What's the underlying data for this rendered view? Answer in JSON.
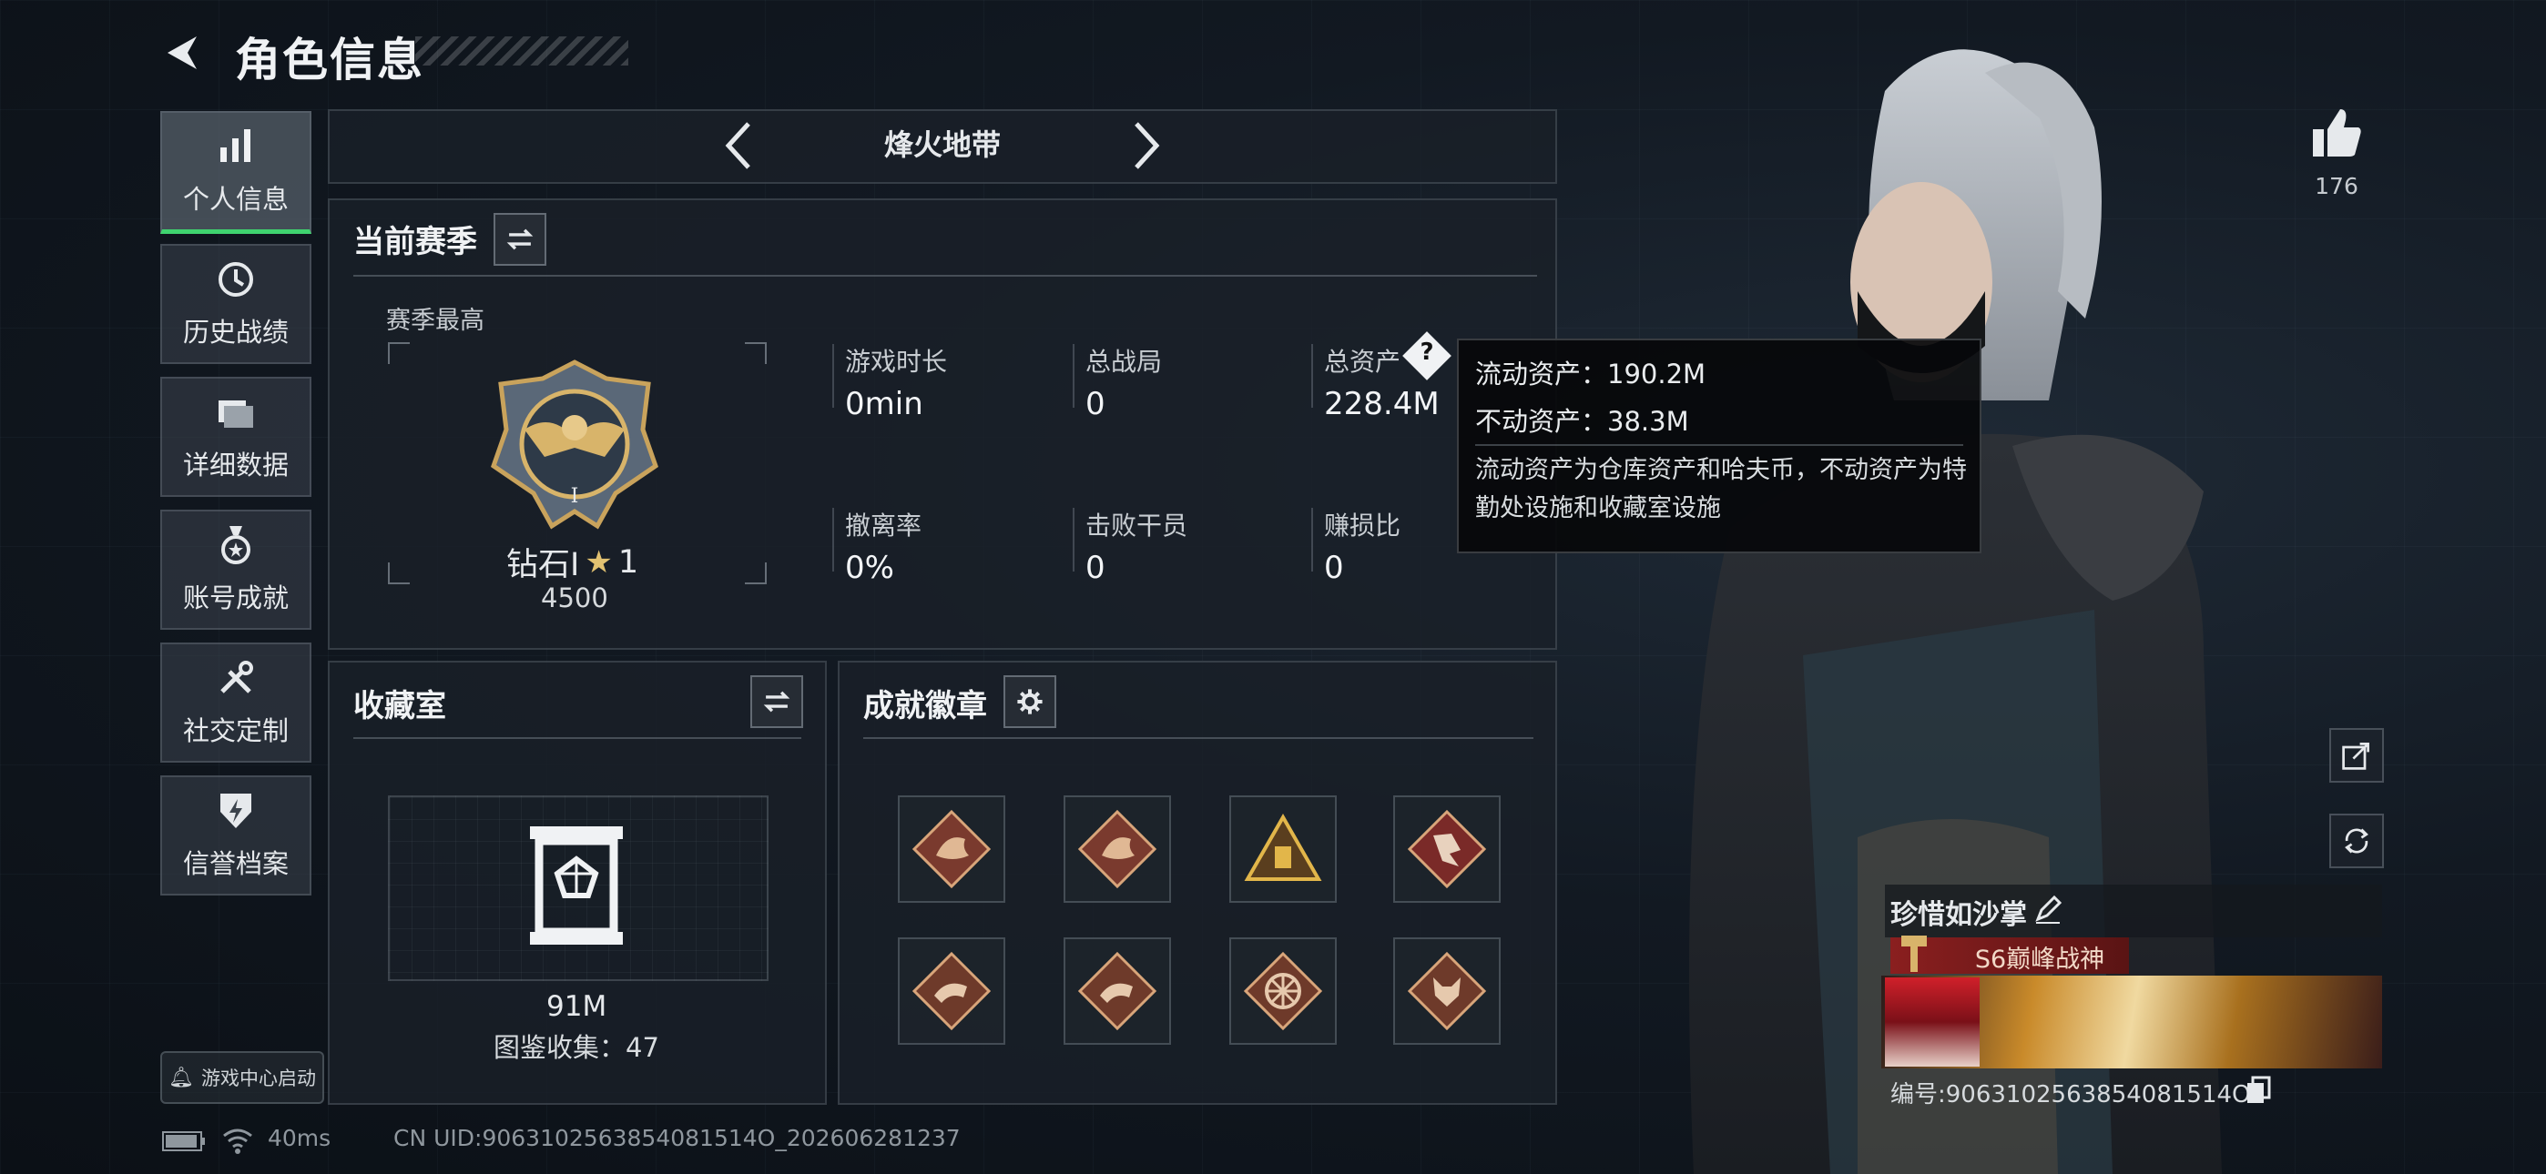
{
  "header": {
    "title": "角色信息"
  },
  "nav": [
    {
      "label": "个人信息",
      "icon": "bar-chart-icon",
      "active": true
    },
    {
      "label": "历史战绩",
      "icon": "history-icon",
      "active": false
    },
    {
      "label": "详细数据",
      "icon": "folder-icon",
      "active": false
    },
    {
      "label": "账号成就",
      "icon": "medal-icon",
      "active": false
    },
    {
      "label": "社交定制",
      "icon": "tools-icon",
      "active": false
    },
    {
      "label": "信誉档案",
      "icon": "shield-bolt-icon",
      "active": false
    }
  ],
  "game_center_label": "游戏中心启动",
  "mode_selector": {
    "title": "烽火地带"
  },
  "season": {
    "section_title": "当前赛季",
    "best_label": "赛季最高",
    "rank_name": "钻石I",
    "rank_stars": "1",
    "rank_score": "4500",
    "stats": [
      {
        "label": "游戏时长",
        "value": "0min"
      },
      {
        "label": "总战局",
        "value": "0"
      },
      {
        "label": "总资产",
        "value": "228.4M"
      },
      {
        "label": "撤离率",
        "value": "0%"
      },
      {
        "label": "击败干员",
        "value": "0"
      },
      {
        "label": "赚损比",
        "value": "0"
      }
    ]
  },
  "tooltip": {
    "liquid": "流动资产：190.2M",
    "fixed": "不动资产：38.3M",
    "desc": "流动资产为仓库资产和哈夫币，不动资产为特勤处设施和收藏室设施"
  },
  "collection": {
    "section_title": "收藏室",
    "value": "91M",
    "catalog": "图鉴收集：47"
  },
  "achievements": {
    "section_title": "成就徽章",
    "badges": [
      "dragon-badge-icon",
      "dragon-badge-icon",
      "pyramid-badge-icon",
      "runner-badge-icon",
      "snake-badge-icon",
      "snake-badge-icon",
      "wheel-badge-icon",
      "wolf-badge-icon"
    ]
  },
  "likes": {
    "count": "176"
  },
  "player": {
    "name": "珍惜如沙掌",
    "title": "S6巅峰战神",
    "id_text": "编号:9063102563854081514O"
  },
  "status": {
    "ping": "40ms",
    "uid": "CN UID:9063102563854081514O_202606281237"
  },
  "colors": {
    "accent_green": "#3fd36f",
    "rank_red": "#8a1f1f"
  }
}
